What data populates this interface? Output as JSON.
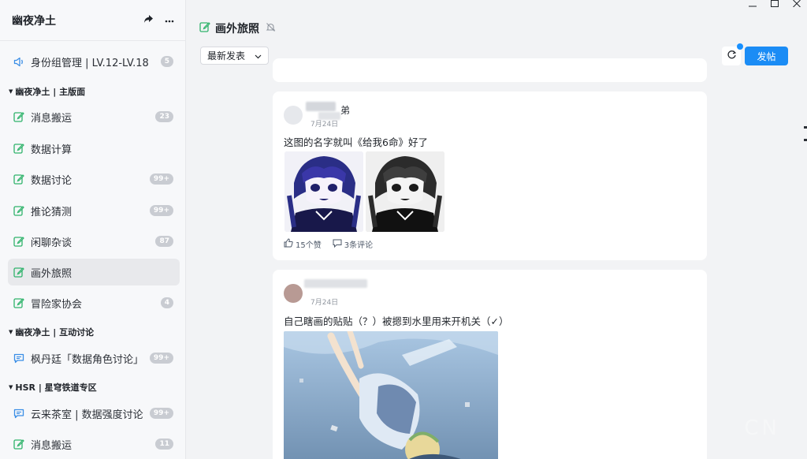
{
  "sidebar": {
    "server_name": "幽夜净土",
    "channels": [
      {
        "label": "身份组管理 | LV.12-LV.18",
        "badge": "5",
        "icon": "speaker-icon"
      },
      {
        "label": "消息搬运",
        "badge": "23",
        "icon": "edit-icon"
      },
      {
        "label": "数据计算",
        "badge": "",
        "icon": "edit-icon"
      },
      {
        "label": "数据讨论",
        "badge": "99+",
        "icon": "edit-icon"
      },
      {
        "label": "推论猜测",
        "badge": "99+",
        "icon": "edit-icon"
      },
      {
        "label": "闲聊杂谈",
        "badge": "87",
        "icon": "edit-icon"
      },
      {
        "label": "画外旅照",
        "badge": "",
        "icon": "edit-icon",
        "active": true
      },
      {
        "label": "冒险家协会",
        "badge": "4",
        "icon": "edit-icon"
      },
      {
        "label": "枫丹廷「数据角色讨论」",
        "badge": "99+",
        "icon": "chat-icon"
      },
      {
        "label": "云来茶室 | 数据强度讨论",
        "badge": "99+",
        "icon": "chat-icon"
      },
      {
        "label": "消息搬运",
        "badge": "11",
        "icon": "edit-icon"
      }
    ],
    "groups": [
      "幽夜净土 | 主版面",
      "幽夜净土 | 互动讨论",
      "HSR | 星穹铁道专区"
    ]
  },
  "main": {
    "title": "画外旅照",
    "sort_label": "最新发表",
    "post_button": "发帖"
  },
  "posts": [
    {
      "author_visible": "弟",
      "date": "7月24日",
      "text": "这图的名字就叫《给我6命》好了",
      "likes": "15个赞",
      "comments": "3条评论"
    },
    {
      "date": "7月24日",
      "text": "自己瞎画的贴贴（？）被摁到水里用来开机关（✓）"
    }
  ],
  "watermark": "CN",
  "colors": {
    "accent": "#1b8cf5",
    "channel_icon": "#2fb36b",
    "chat_icon": "#3a8ee6"
  }
}
